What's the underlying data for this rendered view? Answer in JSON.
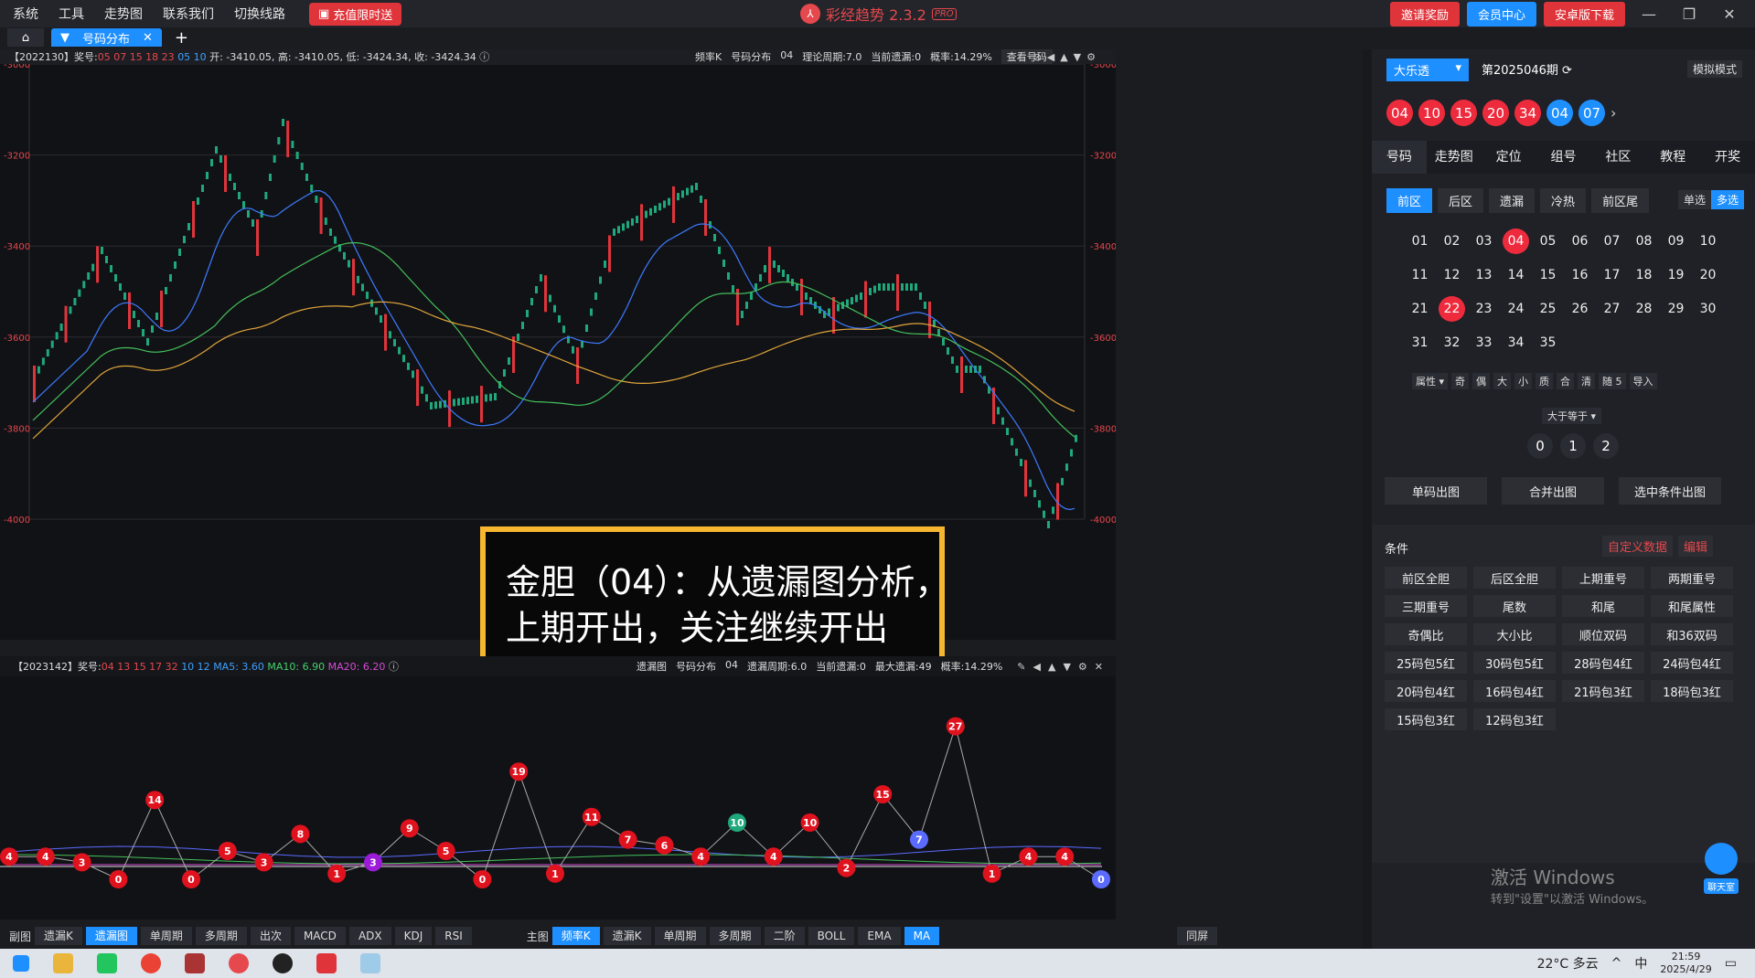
{
  "menu": [
    "系统",
    "工具",
    "走势图",
    "联系我们",
    "切换线路"
  ],
  "promo_label": "充值限时送",
  "app_title": "彩经趋势 2.3.2",
  "app_badge": "PRO",
  "top_buttons": {
    "invite": "邀请奖励",
    "member": "会员中心",
    "android": "安卓版下载"
  },
  "tab_label": "号码分布",
  "chart1": {
    "info_left": "【2022130】奖号: ",
    "info_red": "05 07 15 18 23",
    "info_blue": "05 10",
    "info_ohlc": "开: -3410.05, 高: -3410.05, 低: -3424.34, 收: -3424.34",
    "info_mid": [
      "频率K",
      "号码分布",
      "04",
      "理论周期:7.0",
      "当前遗漏:0",
      "概率:14.29%"
    ],
    "check_btn": "查看号码",
    "yticks": [
      "-3000",
      "-3200",
      "-3400",
      "-3600",
      "-3800",
      "-4000"
    ],
    "callout": [
      "金胆（04）：从遗漏图分析，",
      "上期开出，关注继续开出"
    ]
  },
  "chart2": {
    "info_left": "【2023142】奖号: ",
    "info_red": "04 13 15 17 32",
    "info_blue": "10 12",
    "ma5": "MA5: 3.60",
    "ma10": "MA10: 6.90",
    "ma20": "MA20: 6.20",
    "info_mid": [
      "遗漏图",
      "号码分布",
      "04",
      "遗漏周期:6.0",
      "当前遗漏:0",
      "最大遗漏:49",
      "概率:14.29%"
    ],
    "points": [
      4,
      4,
      3,
      0,
      14,
      0,
      5,
      3,
      8,
      1,
      3,
      9,
      5,
      0,
      19,
      1,
      11,
      7,
      6,
      4,
      10,
      4,
      10,
      2,
      15,
      7,
      27,
      1,
      4,
      4,
      0
    ],
    "colors": [
      "red",
      "red",
      "red",
      "red",
      "red",
      "red",
      "red",
      "red",
      "red",
      "red",
      "purple",
      "red",
      "red",
      "red",
      "red",
      "red",
      "red",
      "red",
      "red",
      "red",
      "green",
      "red",
      "red",
      "red",
      "red",
      "blue",
      "red",
      "red",
      "red",
      "red",
      "blue"
    ]
  },
  "bottom": {
    "left_label": "副图",
    "left": [
      {
        "t": "遗漏K",
        "on": false
      },
      {
        "t": "遗漏图",
        "on": true
      },
      {
        "t": "单周期",
        "on": false
      },
      {
        "t": "多周期",
        "on": false
      },
      {
        "t": "出次",
        "on": false
      },
      {
        "t": "MACD",
        "on": false
      },
      {
        "t": "ADX",
        "on": false
      },
      {
        "t": "KDJ",
        "on": false
      },
      {
        "t": "RSI",
        "on": false
      }
    ],
    "mid_label": "主图",
    "right": [
      {
        "t": "频率K",
        "on": true
      },
      {
        "t": "遗漏K",
        "on": false
      },
      {
        "t": "单周期",
        "on": false
      },
      {
        "t": "多周期",
        "on": false
      },
      {
        "t": "二阶",
        "on": false
      },
      {
        "t": "BOLL",
        "on": false
      },
      {
        "t": "EMA",
        "on": false
      },
      {
        "t": "MA",
        "on": true
      }
    ],
    "sync": "同屏"
  },
  "panel": {
    "lottery": "大乐透",
    "period": "第2025046期",
    "sim": "模拟模式",
    "balls": [
      {
        "n": "04",
        "c": "red"
      },
      {
        "n": "10",
        "c": "red"
      },
      {
        "n": "15",
        "c": "red"
      },
      {
        "n": "20",
        "c": "red"
      },
      {
        "n": "34",
        "c": "red"
      },
      {
        "n": "04",
        "c": "blue"
      },
      {
        "n": "07",
        "c": "blue"
      }
    ],
    "nav": [
      "号码",
      "走势图",
      "定位",
      "组号",
      "社区",
      "教程",
      "开奖"
    ],
    "filters": [
      "前区",
      "后区",
      "遗漏",
      "冷热",
      "前区尾"
    ],
    "single": "单选",
    "multi": "多选",
    "numbers": [
      "01",
      "02",
      "03",
      "04",
      "05",
      "06",
      "07",
      "08",
      "09",
      "10",
      "11",
      "12",
      "13",
      "14",
      "15",
      "16",
      "17",
      "18",
      "19",
      "20",
      "21",
      "22",
      "23",
      "24",
      "25",
      "26",
      "27",
      "28",
      "29",
      "30",
      "31",
      "32",
      "33",
      "34",
      "35"
    ],
    "selected": [
      "04",
      "22"
    ],
    "attrs": [
      "属性 ▾",
      "奇",
      "偶",
      "大",
      "小",
      "质",
      "合",
      "清",
      "随 5",
      "导入"
    ],
    "gte": "大于等于 ▾",
    "circles": [
      "0",
      "1",
      "2"
    ],
    "actions": [
      "单码出图",
      "合并出图",
      "选中条件出图"
    ],
    "cond_title": "条件",
    "custom": "自定义数据",
    "edit": "编辑",
    "conds": [
      "前区全胆",
      "后区全胆",
      "上期重号",
      "两期重号",
      "三期重号",
      "尾数",
      "和尾",
      "和尾属性",
      "奇偶比",
      "大小比",
      "顺位双码",
      "和36双码",
      "25码包5红",
      "30码包5红",
      "28码包4红",
      "24码包4红",
      "20码包4红",
      "16码包4红",
      "21码包3红",
      "18码包3红",
      "15码包3红",
      "12码包3红"
    ],
    "watermark": "激活 Windows",
    "watermark_sub": "转到\"设置\"以激活 Windows。",
    "chat": "聊天室"
  },
  "taskbar": {
    "weather": "22°C 多云",
    "ime": "中",
    "time": "21:59",
    "date": "2025/4/29"
  }
}
